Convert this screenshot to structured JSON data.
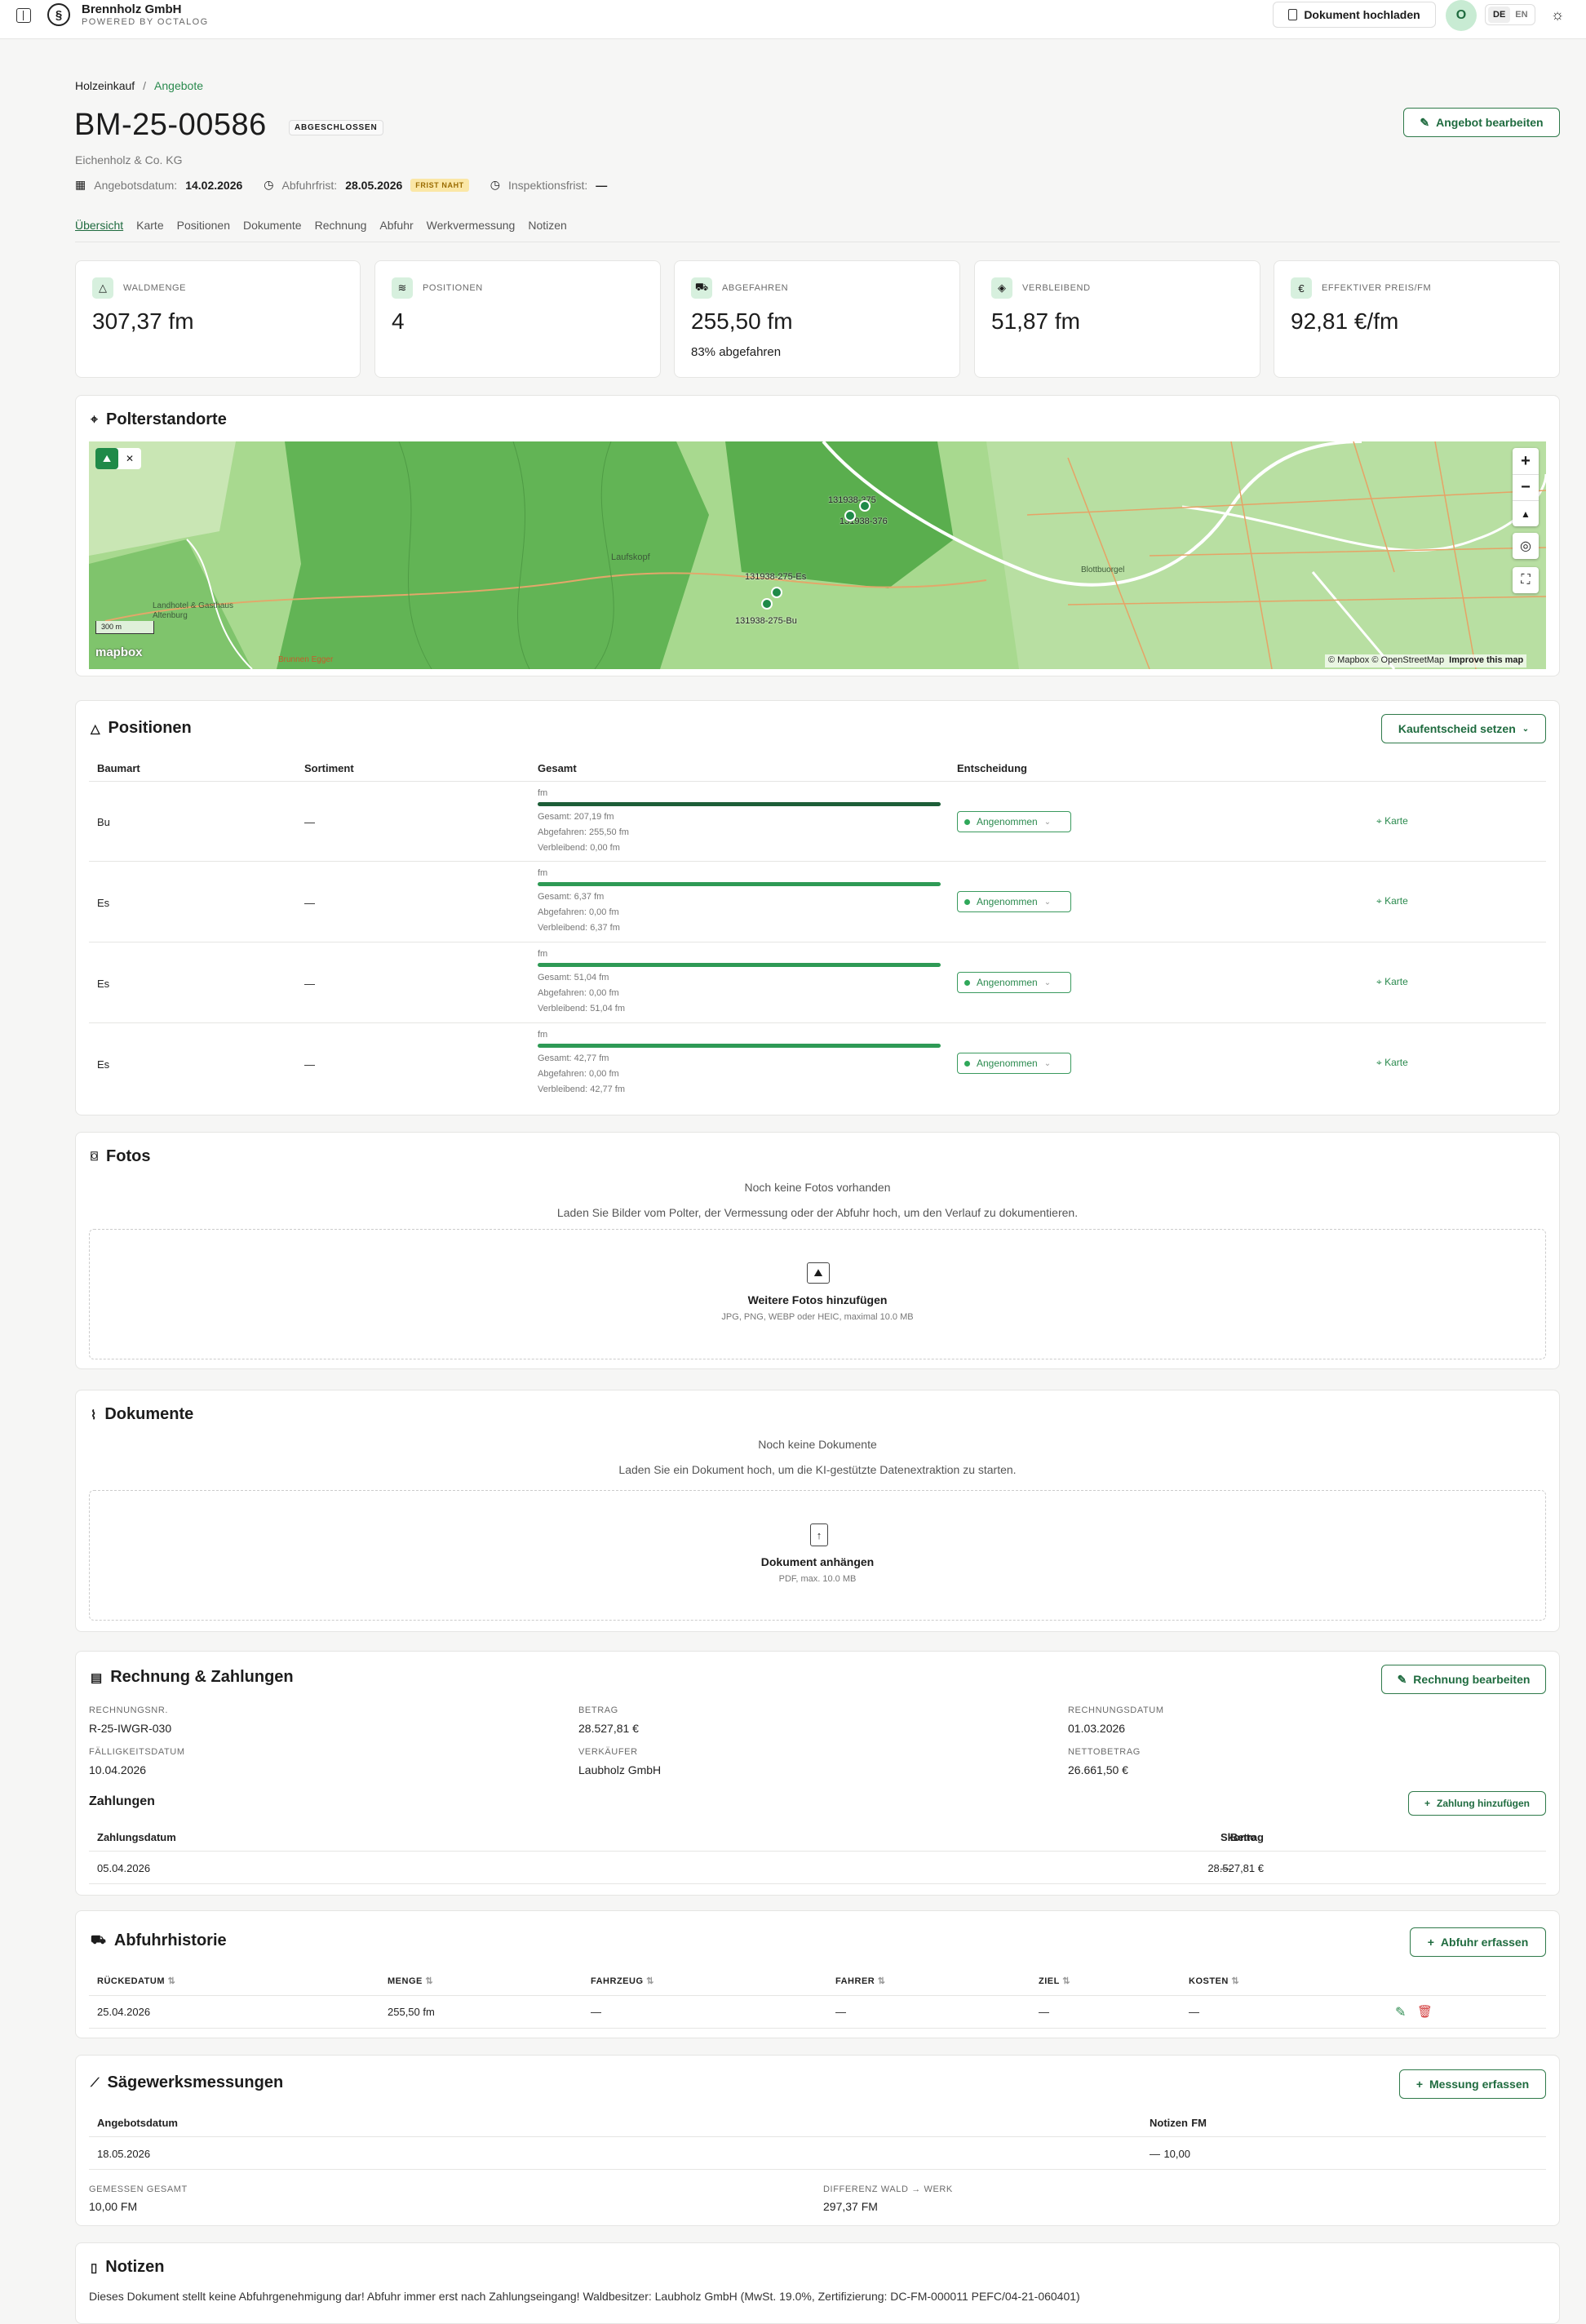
{
  "topbar": {
    "company": "Brennholz GmbH",
    "powered": "POWERED BY OCTALOG",
    "upload": "Dokument hochladen",
    "avatar": "O",
    "lang_de": "DE",
    "lang_en": "EN"
  },
  "breadcrumb": {
    "parent": "Holzeinkauf",
    "sep": "/",
    "current": "Angebote"
  },
  "header": {
    "title": "BM-25-00586",
    "status": "ABGESCHLOSSEN",
    "company": "Eichenholz & Co. KG",
    "edit": "Angebot bearbeiten",
    "date_label": "Angebotsdatum:",
    "date_value": "14.02.2026",
    "pickup_label": "Abfuhrfrist:",
    "pickup_value": "28.05.2026",
    "pickup_badge": "FRIST NAHT",
    "insp_label": "Inspektionsfrist:",
    "insp_value": "—"
  },
  "tabs": [
    "Übersicht",
    "Karte",
    "Positionen",
    "Dokumente",
    "Rechnung",
    "Abfuhr",
    "Werkvermessung",
    "Notizen"
  ],
  "stats": [
    {
      "label": "WALDMENGE",
      "value": "307,37 fm",
      "sub": ""
    },
    {
      "label": "POSITIONEN",
      "value": "4",
      "sub": ""
    },
    {
      "label": "ABGEFAHREN",
      "value": "255,50 fm",
      "sub": "83% abgefahren"
    },
    {
      "label": "VERBLEIBEND",
      "value": "51,87 fm",
      "sub": ""
    },
    {
      "label": "EFFEKTIVER PREIS/FM",
      "value": "92,81 €/fm",
      "sub": ""
    }
  ],
  "map": {
    "title": "Polterstandorte",
    "scale": "300 m",
    "logo": "mapbox",
    "attrib": "© Mapbox © OpenStreetMap",
    "improve": "Improve this map",
    "places": [
      "Laufskopf",
      "Landhotel & Gasthaus Altenburg",
      "Blottbuorgel",
      "Brunnen Egger"
    ],
    "markers": [
      "131938-375",
      "131938-376",
      "131938-275-Es",
      "131938-275-Bu"
    ]
  },
  "positions": {
    "title": "Positionen",
    "action": "Kaufentscheid setzen",
    "headers": [
      "Baumart",
      "Sortiment",
      "Gesamt",
      "Entscheidung"
    ],
    "rows": [
      {
        "species": "Bu",
        "sort": "—",
        "unit": "fm",
        "total": "Gesamt: 207,19 fm",
        "done": "Abgefahren: 255,50 fm",
        "rest": "Verbleibend: 0,00 fm",
        "decision": "Angenommen",
        "map": "Karte",
        "fill": 1.0
      },
      {
        "species": "Es",
        "sort": "—",
        "unit": "fm",
        "total": "Gesamt: 6,37 fm",
        "done": "Abgefahren: 0,00 fm",
        "rest": "Verbleibend: 6,37 fm",
        "decision": "Angenommen",
        "map": "Karte",
        "fill": 1.0
      },
      {
        "species": "Es",
        "sort": "—",
        "unit": "fm",
        "total": "Gesamt: 51,04 fm",
        "done": "Abgefahren: 0,00 fm",
        "rest": "Verbleibend: 51,04 fm",
        "decision": "Angenommen",
        "map": "Karte",
        "fill": 1.0
      },
      {
        "species": "Es",
        "sort": "—",
        "unit": "fm",
        "total": "Gesamt: 42,77 fm",
        "done": "Abgefahren: 0,00 fm",
        "rest": "Verbleibend: 42,77 fm",
        "decision": "Angenommen",
        "map": "Karte",
        "fill": 1.0
      }
    ]
  },
  "photos": {
    "title": "Fotos",
    "empty": "Noch keine Fotos vorhanden",
    "hint": "Laden Sie Bilder vom Polter, der Vermessung oder der Abfuhr hoch, um den Verlauf zu dokumentieren.",
    "add": "Weitere Fotos hinzufügen",
    "formats": "JPG, PNG, WEBP oder HEIC, maximal 10.0 MB"
  },
  "docs": {
    "title": "Dokumente",
    "empty": "Noch keine Dokumente",
    "hint": "Laden Sie ein Dokument hoch, um die KI-gestützte Datenextraktion zu starten.",
    "add": "Dokument anhängen",
    "formats": "PDF, max. 10.0 MB"
  },
  "invoice": {
    "title": "Rechnung & Zahlungen",
    "edit": "Rechnung bearbeiten",
    "no_label": "RECHNUNGSNR.",
    "no": "R-25-IWGR-030",
    "amount_label": "BETRAG",
    "amount": "28.527,81 €",
    "date_label": "RECHNUNGSDATUM",
    "date": "01.03.2026",
    "due_label": "FÄLLIGKEITSDATUM",
    "due": "10.04.2026",
    "seller_label": "VERKÄUFER",
    "seller": "Laubholz GmbH",
    "net_label": "NETTOBETRAG",
    "net": "26.661,50 €",
    "payments_title": "Zahlungen",
    "add_payment": "Zahlung hinzufügen",
    "pay_headers": [
      "Zahlungsdatum",
      "Betrag",
      "Skonto"
    ],
    "payment": {
      "date": "05.04.2026",
      "amount": "28.527,81 €",
      "skonto": "—"
    }
  },
  "pickup": {
    "title": "Abfuhrhistorie",
    "action": "Abfuhr erfassen",
    "headers": [
      "RÜCKEDATUM",
      "MENGE",
      "FAHRZEUG",
      "FAHRER",
      "ZIEL",
      "KOSTEN"
    ],
    "row": [
      "25.04.2026",
      "255,50 fm",
      "—",
      "—",
      "—",
      "—"
    ]
  },
  "saw": {
    "title": "Sägewerksmessungen",
    "action": "Messung erfassen",
    "headers": [
      "Angebotsdatum",
      "FM",
      "Notizen"
    ],
    "row": [
      "18.05.2026",
      "10,00",
      "—"
    ],
    "total_label": "GEMESSEN GESAMT",
    "total": "10,00 FM",
    "diff_label": "DIFFERENZ WALD → WERK",
    "diff": "297,37 FM"
  },
  "notes": {
    "title": "Notizen",
    "text": "Dieses Dokument stellt keine Abfuhrgenehmigung dar! Abfuhr immer erst nach Zahlungseingang! Waldbesitzer: Laubholz GmbH (MwSt. 19.0%, Zertifizierung: DC-FM-000011 PEFC/04-21-060401)"
  },
  "colors": {
    "accent": "#1f6b3f",
    "bar": "#2e9a55",
    "badge": "#fbe7a6"
  }
}
